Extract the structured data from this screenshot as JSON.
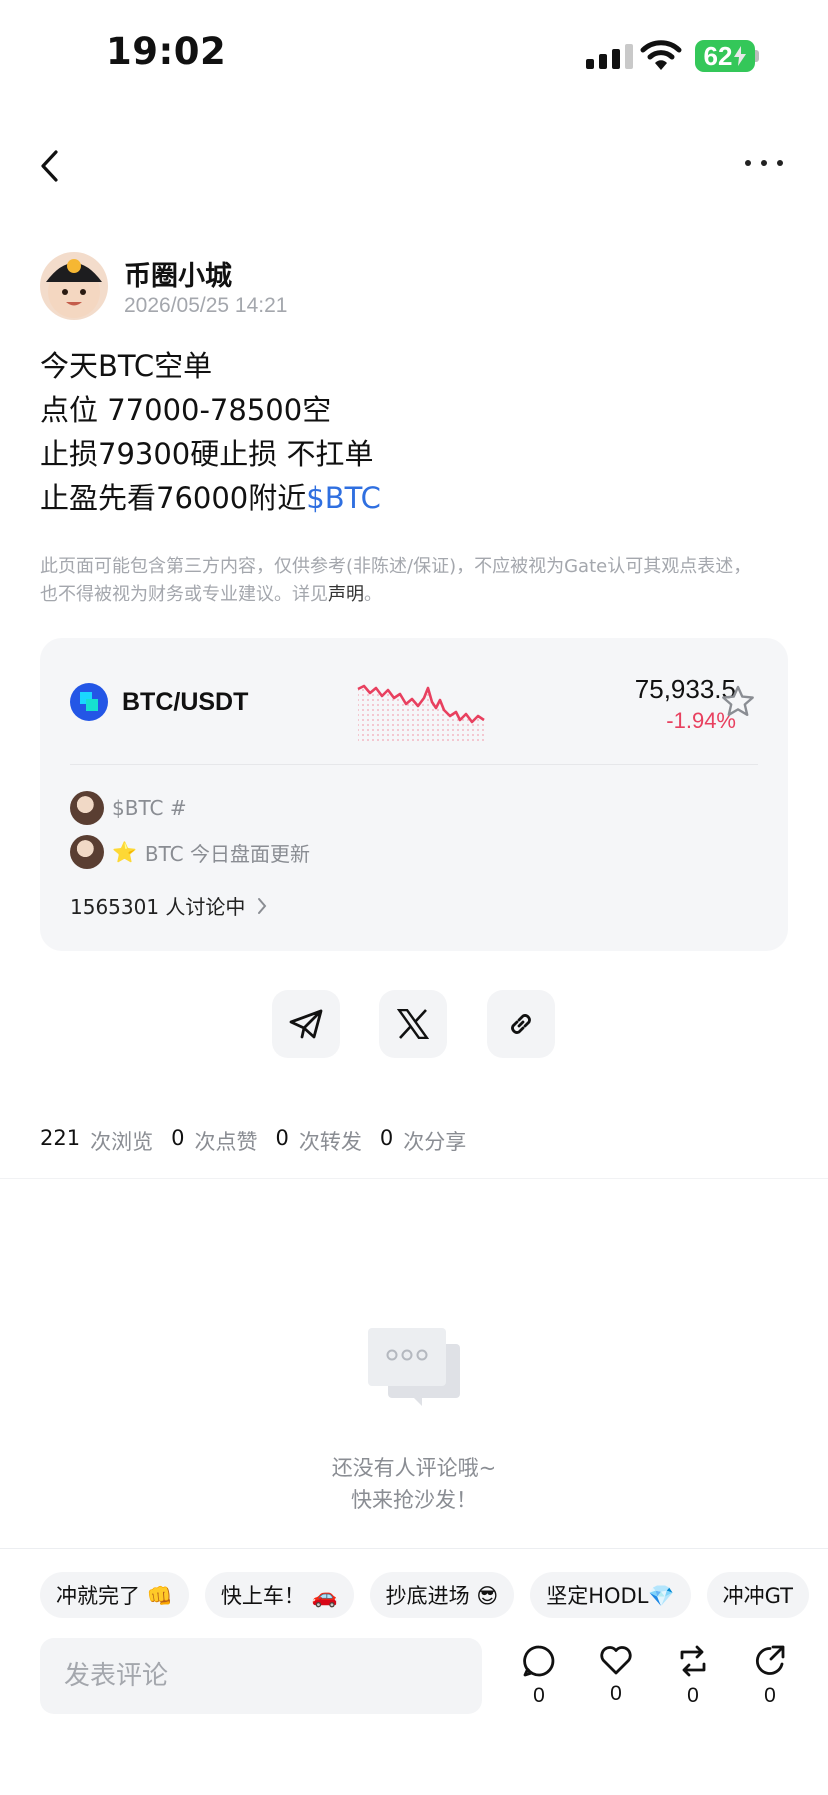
{
  "status_bar": {
    "time": "19:02",
    "battery": "62"
  },
  "author": {
    "name": "币圈小城",
    "time": "2026/05/25 14:21"
  },
  "post": {
    "lines": [
      "今天BTC空单",
      "点位 77000-78500空",
      "止损79300硬止损 不扛单",
      "止盈先看76000附近"
    ],
    "cashtag": "$BTC"
  },
  "disclaimer": {
    "text": "此页面可能包含第三方内容，仅供参考(非陈述/保证)，不应被视为Gate认可其观点表述，也不得被视为财务或专业建议。详见",
    "link": "声明",
    "end": "。"
  },
  "market": {
    "pair": "BTC/USDT",
    "price": "75,933.5",
    "change": "-1.94%",
    "topics": [
      {
        "text": "$BTC #"
      },
      {
        "icon": "⭐",
        "text": "BTC 今日盘面更新"
      }
    ],
    "discussing": "1565301 人讨论中",
    "colors": {
      "down": "#e8405f",
      "logo": "#2356e6"
    }
  },
  "share": {
    "buttons": [
      "telegram-icon",
      "x-icon",
      "link-icon"
    ]
  },
  "stats": [
    {
      "num": "221",
      "label": "次浏览"
    },
    {
      "num": "0",
      "label": "次点赞"
    },
    {
      "num": "0",
      "label": "次转发"
    },
    {
      "num": "0",
      "label": "次分享"
    }
  ],
  "empty": {
    "line1": "还没有人评论哦~",
    "line2": "快来抢沙发！"
  },
  "chips": [
    "冲就完了 👊",
    "快上车！ 🚗",
    "抄底进场 😎",
    "坚定HODL💎",
    "冲冲GT"
  ],
  "comment": {
    "placeholder": "发表评论"
  },
  "actions": [
    {
      "icon": "comment-icon",
      "count": "0"
    },
    {
      "icon": "like-icon",
      "count": "0"
    },
    {
      "icon": "repost-icon",
      "count": "0"
    },
    {
      "icon": "share-icon",
      "count": "0"
    }
  ]
}
